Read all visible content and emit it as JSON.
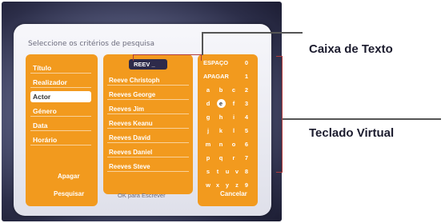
{
  "dialog": {
    "title": "Seleccione os critérios de pesquisa",
    "criteria": [
      "Título",
      "Realizador",
      "Actor",
      "Género",
      "Data",
      "Horário"
    ],
    "selected_criterion": "Actor",
    "buttons": {
      "clear": "Apagar",
      "search": "Pesquisar",
      "cancel": "Cancelar"
    },
    "text_box_value": "REEV _",
    "results": [
      "Reeve Christoph",
      "Reeves George",
      "Reeves Jim",
      "Reeves Keanu",
      "Reeves David",
      "Reeves Daniel",
      "Reeves Steve"
    ],
    "footer_hint": "OK para Escrever"
  },
  "keyboard": {
    "rows": [
      [
        "ESPAÇO",
        "0"
      ],
      [
        "APAGAR",
        "1"
      ],
      [
        "a",
        "b",
        "c",
        "2"
      ],
      [
        "d",
        "e",
        "f",
        "3"
      ],
      [
        "g",
        "h",
        "i",
        "4"
      ],
      [
        "j",
        "k",
        "l",
        "5"
      ],
      [
        "m",
        "n",
        "o",
        "6"
      ],
      [
        "p",
        "q",
        "r",
        "7"
      ],
      [
        "s",
        "t",
        "u",
        "v",
        "8"
      ],
      [
        "w",
        "x",
        "y",
        "z",
        "9"
      ]
    ],
    "selected_key": "e"
  },
  "callouts": {
    "text_box": "Caixa de Texto",
    "virtual_keyboard": "Teclado Virtual"
  },
  "colors": {
    "panel": "#f29a1e",
    "textbox": "#2d2a4a",
    "dialog": "#eeeef4",
    "bracket": "#b23b3b"
  }
}
